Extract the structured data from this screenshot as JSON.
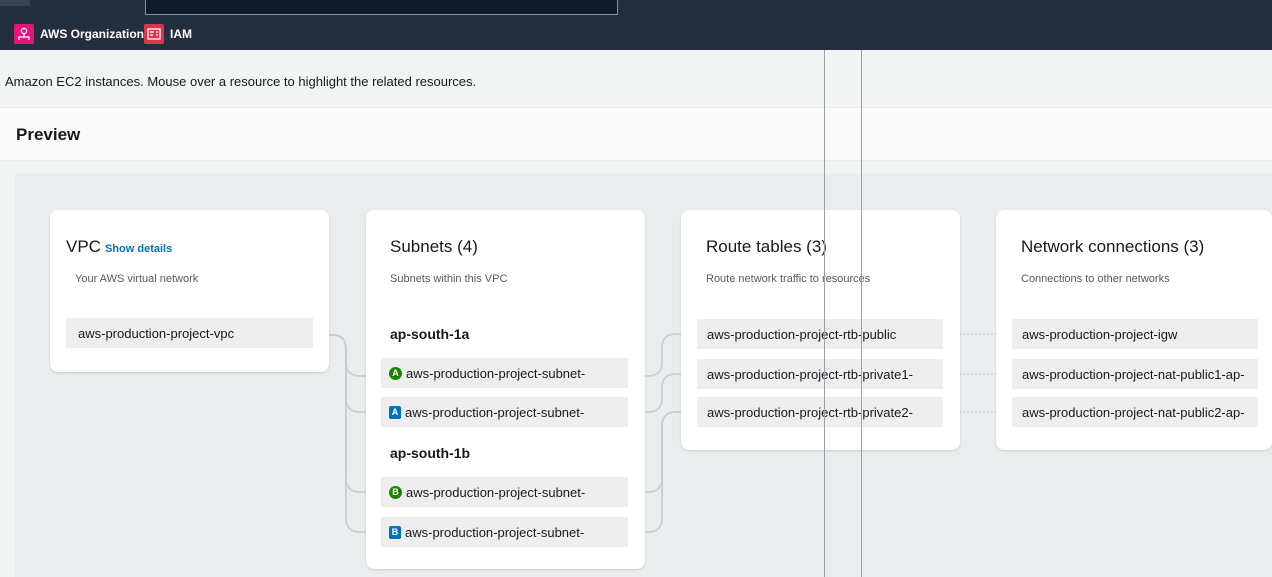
{
  "nav": {
    "favorites": [
      {
        "label": "AWS Organizations",
        "icon": "aws-organizations-icon"
      },
      {
        "label": "IAM",
        "icon": "iam-icon"
      }
    ]
  },
  "intro_text": "Amazon EC2 instances. Mouse over a resource to highlight the related resources.",
  "preview": {
    "title": "Preview"
  },
  "vpc": {
    "title": "VPC",
    "show_details": "Show details",
    "description": "Your AWS virtual network",
    "resource": "aws-production-project-vpc"
  },
  "subnets": {
    "title": "Subnets (4)",
    "description": "Subnets within this VPC",
    "zones": [
      {
        "name": "ap-south-1a",
        "items": [
          {
            "badge": "A",
            "badge_color": "#1d8102",
            "label": "aws-production-project-subnet-"
          },
          {
            "badge": "A",
            "badge_color": "#0073bb",
            "label": "aws-production-project-subnet-"
          }
        ]
      },
      {
        "name": "ap-south-1b",
        "items": [
          {
            "badge": "B",
            "badge_color": "#1d8102",
            "label": "aws-production-project-subnet-"
          },
          {
            "badge": "B",
            "badge_color": "#0073bb",
            "label": "aws-production-project-subnet-"
          }
        ]
      }
    ]
  },
  "route_tables": {
    "title": "Route tables (3)",
    "description": "Route network traffic to resources",
    "items": [
      "aws-production-project-rtb-public",
      "aws-production-project-rtb-private1-",
      "aws-production-project-rtb-private2-"
    ]
  },
  "network_connections": {
    "title": "Network connections (3)",
    "description": "Connections to other networks",
    "items": [
      "aws-production-project-igw",
      "aws-production-project-nat-public1-ap-",
      "aws-production-project-nat-public2-ap-"
    ]
  },
  "colors": {
    "topbar": "#232f3e",
    "link": "#0073bb",
    "subnet_public": "#1d8102",
    "subnet_private": "#0073bb"
  }
}
